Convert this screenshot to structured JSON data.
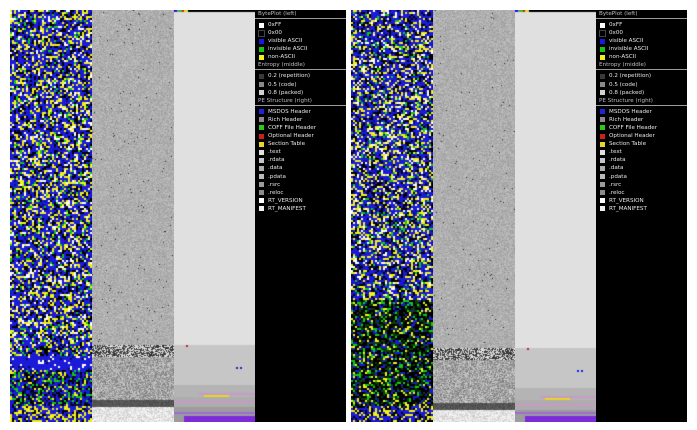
{
  "panes": [
    {
      "id": "left",
      "legend": {
        "byteplot": {
          "header": "BytePlot (left)",
          "items": [
            {
              "label": "0xFF",
              "color": "#ffffff"
            },
            {
              "label": "0x00",
              "color": "#000000"
            },
            {
              "label": "visible ASCII",
              "color": "#1a1ad8"
            },
            {
              "label": "invisible ASCII",
              "color": "#12c812"
            },
            {
              "label": "non-ASCII",
              "color": "#f2f21a"
            }
          ]
        },
        "entropy": {
          "header": "Entropy (middle)",
          "items": [
            {
              "label": "0.2 (repetition)",
              "color": "#3a3a3a"
            },
            {
              "label": "0.5 (code)",
              "color": "#8a8a8a"
            },
            {
              "label": "0.8 (packed)",
              "color": "#d2d2d2"
            }
          ]
        },
        "pe": {
          "header": "PE Structure (right)",
          "items": [
            {
              "label": "MSDOS Header",
              "color": "#2020e0"
            },
            {
              "label": "Rich Header",
              "color": "#8a8a8a"
            },
            {
              "label": "COFF File Header",
              "color": "#22cc22"
            },
            {
              "label": "Optional Header",
              "color": "#cc2020"
            },
            {
              "label": "Section Table",
              "color": "#e8d820"
            },
            {
              "label": ".text",
              "color": "#e0e0e0"
            },
            {
              "label": ".rdata",
              "color": "#c6c6c6"
            },
            {
              "label": ".data",
              "color": "#adadad"
            },
            {
              "label": ".pdata",
              "color": "#bababa"
            },
            {
              "label": ".rsrc",
              "color": "#9c9c9c"
            },
            {
              "label": ".reloc",
              "color": "#8c8c8c"
            },
            {
              "label": "RT_VERSION",
              "color": "#ffffff"
            },
            {
              "label": "RT_MANIFEST",
              "color": "#f0f0f0"
            }
          ]
        }
      }
    },
    {
      "id": "right",
      "legend": {
        "byteplot": {
          "header": "BytePlot (left)",
          "items": [
            {
              "label": "0xFF",
              "color": "#ffffff"
            },
            {
              "label": "0x00",
              "color": "#000000"
            },
            {
              "label": "visible ASCII",
              "color": "#1a1ad8"
            },
            {
              "label": "invisible ASCII",
              "color": "#12c812"
            },
            {
              "label": "non-ASCII",
              "color": "#f2f21a"
            }
          ]
        },
        "entropy": {
          "header": "Entropy (middle)",
          "items": [
            {
              "label": "0.2 (repetition)",
              "color": "#3a3a3a"
            },
            {
              "label": "0.5 (code)",
              "color": "#8a8a8a"
            },
            {
              "label": "0.8 (packed)",
              "color": "#d2d2d2"
            }
          ]
        },
        "pe": {
          "header": "PE Structure (right)",
          "items": [
            {
              "label": "MSDOS Header",
              "color": "#2020e0"
            },
            {
              "label": "Rich Header",
              "color": "#8a8a8a"
            },
            {
              "label": "COFF File Header",
              "color": "#22cc22"
            },
            {
              "label": "Optional Header",
              "color": "#cc2020"
            },
            {
              "label": "Section Table",
              "color": "#e8d820"
            },
            {
              "label": ".text",
              "color": "#e0e0e0"
            },
            {
              "label": ".rdata",
              "color": "#c6c6c6"
            },
            {
              "label": ".data",
              "color": "#adadad"
            },
            {
              "label": ".pdata",
              "color": "#bababa"
            },
            {
              "label": ".rsrc",
              "color": "#9c9c9c"
            },
            {
              "label": ".reloc",
              "color": "#8c8c8c"
            },
            {
              "label": "RT_VERSION",
              "color": "#ffffff"
            },
            {
              "label": "RT_MANIFEST",
              "color": "#f0f0f0"
            }
          ]
        }
      }
    }
  ]
}
